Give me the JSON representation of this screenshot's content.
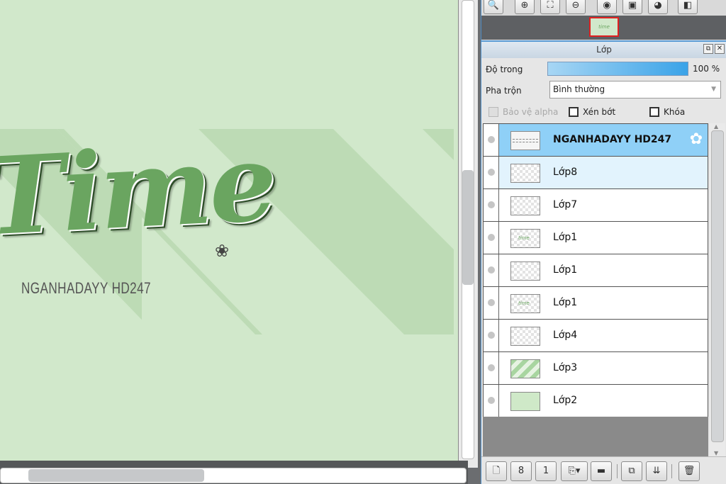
{
  "canvas": {
    "art_title": "Time",
    "art_subtitle": "NGANHADAYY HD247",
    "art_flower": "❀"
  },
  "navigator": {
    "buttons": [
      {
        "name": "zoom-fit-icon",
        "glyph": "🔍"
      },
      {
        "name": "zoom-in-icon",
        "glyph": "⊕"
      },
      {
        "name": "fullscreen-icon",
        "glyph": "⛶"
      },
      {
        "name": "zoom-out-icon",
        "glyph": "⊖"
      },
      {
        "name": "rotate-icon",
        "glyph": "◉"
      },
      {
        "name": "flip-icon",
        "glyph": "▣"
      },
      {
        "name": "reset-icon",
        "glyph": "◕"
      },
      {
        "name": "panel-icon",
        "glyph": "◧"
      }
    ],
    "thumb_mark": "time"
  },
  "layer_panel": {
    "title": "Lớp",
    "popout_glyph": "⧉",
    "close_glyph": "✕",
    "opacity_label": "Độ trong",
    "opacity_value": "100 %",
    "opacity_fraction": 1.0,
    "blend_label": "Pha trộn",
    "blend_value": "Bình thường",
    "blend_arrow": "▼",
    "protect_alpha": "Bảo vệ alpha",
    "clipping": "Xén bớt",
    "lock": "Khóa",
    "layers": [
      {
        "name": "NGANHADAYY HD247",
        "thumb": "text",
        "state": "active",
        "gear": "✿"
      },
      {
        "name": "Lớp8",
        "thumb": "empty",
        "state": "hover"
      },
      {
        "name": "Lớp7",
        "thumb": "empty",
        "state": ""
      },
      {
        "name": "Lớp1",
        "thumb": "mark",
        "state": ""
      },
      {
        "name": "Lớp1",
        "thumb": "empty",
        "state": ""
      },
      {
        "name": "Lớp1",
        "thumb": "mark",
        "state": ""
      },
      {
        "name": "Lớp4",
        "thumb": "empty",
        "state": ""
      },
      {
        "name": "Lớp3",
        "thumb": "stripes",
        "state": ""
      },
      {
        "name": "Lớp2",
        "thumb": "green",
        "state": ""
      }
    ],
    "scroll_up": "▲",
    "scroll_down": "▼",
    "toolbar": [
      {
        "name": "new-layer-icon",
        "glyph": "🗋"
      },
      {
        "name": "new-8bit-layer-icon",
        "glyph": "8"
      },
      {
        "name": "new-1bit-layer-icon",
        "glyph": "1"
      },
      {
        "name": "add-layer-menu-icon",
        "glyph": "⎘▾"
      },
      {
        "name": "folder-icon",
        "glyph": "▬"
      },
      {
        "name": "duplicate-layer-icon",
        "glyph": "⧉"
      },
      {
        "name": "merge-layer-icon",
        "glyph": "⇊"
      },
      {
        "name": "trash-icon",
        "glyph": "🗑"
      }
    ]
  },
  "colors": {
    "canvas_bg": "#d1e8cb",
    "stripe": "#bddbb5",
    "active_layer": "#8fd0f7",
    "accent": "#4e8dc5"
  }
}
